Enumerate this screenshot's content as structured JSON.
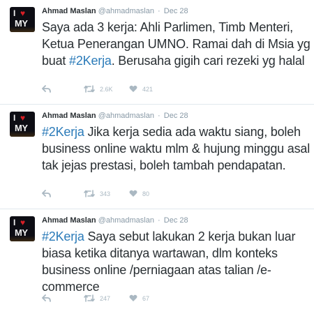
{
  "tweets": [
    {
      "name": "Ahmad Maslan",
      "handle": "@ahmadmaslan",
      "time": "Dec 28",
      "text_before": "Saya ada 3 kerja: Ahli Parlimen, Timb Menteri, Ketua Penerangan UMNO. Ramai dah di Msia yg buat ",
      "hashtag": "#2Kerja",
      "text_after": ". Berusaha gigih cari rezeki yg halal",
      "retweets": "2.6K",
      "likes": "421"
    },
    {
      "name": "Ahmad Maslan",
      "handle": "@ahmadmaslan",
      "time": "Dec 28",
      "text_before": "",
      "hashtag": "#2Kerja",
      "text_after": " Jika kerja sedia ada waktu siang, boleh business online waktu mlm & hujung minggu asal tak jejas prestasi, boleh tambah pendapatan.",
      "retweets": "343",
      "likes": "80"
    },
    {
      "name": "Ahmad Maslan",
      "handle": "@ahmadmaslan",
      "time": "Dec 28",
      "text_before": "",
      "hashtag": "#2Kerja",
      "text_after": " Saya sebut lakukan 2 kerja bukan luar biasa ketika ditanya wartawan, dlm konteks business online /perniagaan atas talian /e-commerce",
      "retweets": "247",
      "likes": "67"
    }
  ],
  "icons": {
    "reply": "reply-icon",
    "retweet": "retweet-icon",
    "like": "heart-icon"
  },
  "colors": {
    "hashtag": "#2b7bb9",
    "meta": "#8899a6",
    "action": "#aab8c2"
  },
  "avatar_text": {
    "top": "I",
    "bottom": "MY"
  }
}
